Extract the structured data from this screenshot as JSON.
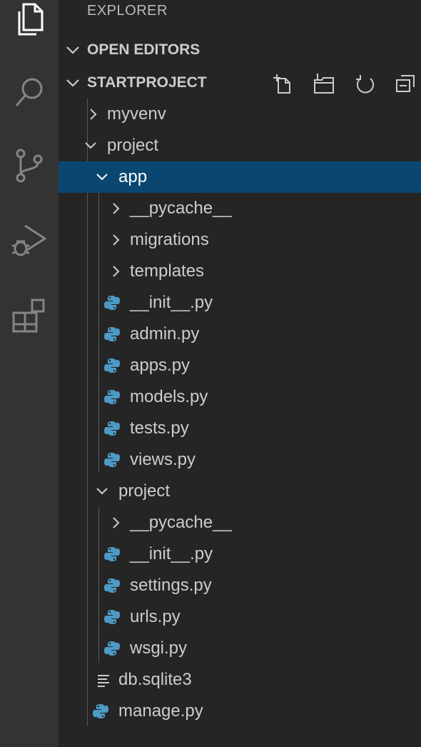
{
  "activity_bar": {
    "items": [
      {
        "icon": "files-icon",
        "active": true
      },
      {
        "icon": "search-icon"
      },
      {
        "icon": "source-control-icon"
      },
      {
        "icon": "run-debug-icon"
      },
      {
        "icon": "extensions-icon"
      }
    ]
  },
  "explorer": {
    "title": "EXPLORER",
    "open_editors_label": "OPEN EDITORS",
    "project_label": "STARTPROJECT",
    "actions": [
      "new-file-icon",
      "new-folder-icon",
      "refresh-icon",
      "collapse-all-icon"
    ]
  },
  "tree": [
    {
      "name": "myvenv",
      "type": "folder",
      "expanded": false
    },
    {
      "name": "project",
      "type": "folder",
      "expanded": true
    },
    {
      "name": "app",
      "type": "folder",
      "expanded": true,
      "selected": true
    },
    {
      "name": "__pycache__",
      "type": "folder",
      "expanded": false
    },
    {
      "name": "migrations",
      "type": "folder",
      "expanded": false
    },
    {
      "name": "templates",
      "type": "folder",
      "expanded": false
    },
    {
      "name": "__init__.py",
      "type": "python"
    },
    {
      "name": "admin.py",
      "type": "python"
    },
    {
      "name": "apps.py",
      "type": "python"
    },
    {
      "name": "models.py",
      "type": "python"
    },
    {
      "name": "tests.py",
      "type": "python"
    },
    {
      "name": "views.py",
      "type": "python"
    },
    {
      "name": "project",
      "type": "folder",
      "expanded": true
    },
    {
      "name": "__pycache__",
      "type": "folder",
      "expanded": false
    },
    {
      "name": "__init__.py",
      "type": "python"
    },
    {
      "name": "settings.py",
      "type": "python"
    },
    {
      "name": "urls.py",
      "type": "python"
    },
    {
      "name": "wsgi.py",
      "type": "python"
    },
    {
      "name": "db.sqlite3",
      "type": "text"
    },
    {
      "name": "manage.py",
      "type": "python"
    }
  ],
  "colors": {
    "activity_bar": "#333333",
    "sidebar": "#252526",
    "selection": "#094771",
    "python_blue": "#4d9ac6"
  }
}
